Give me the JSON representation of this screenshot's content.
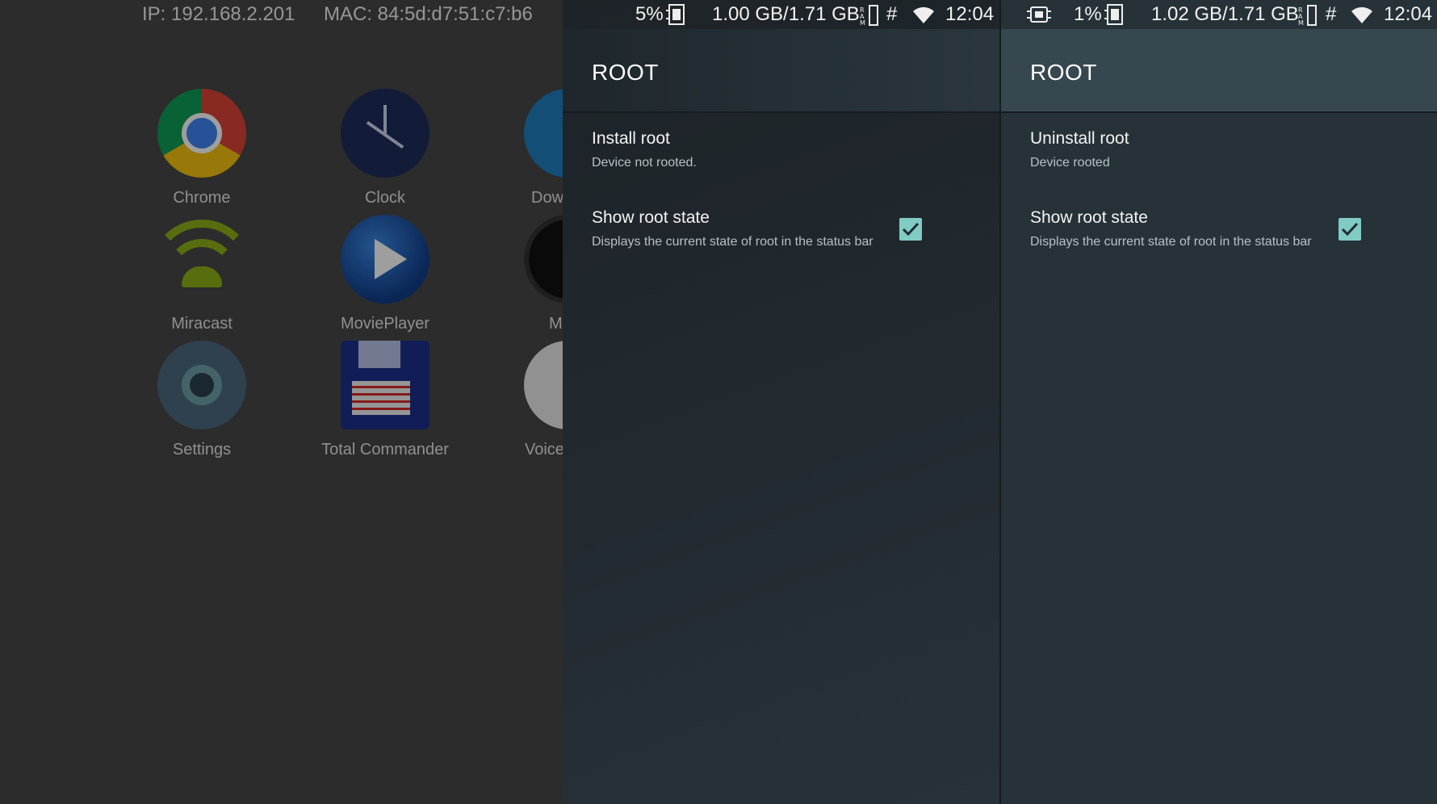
{
  "launcher": {
    "status": {
      "ip": "IP: 192.168.2.201",
      "mac": "MAC: 84:5d:d7:51:c7:b6"
    },
    "apps": [
      {
        "label": "Chrome"
      },
      {
        "label": "Clock"
      },
      {
        "label": "Dow"
      },
      {
        "label": "Miracast"
      },
      {
        "label": "MoviePlayer"
      },
      {
        "label": "M"
      },
      {
        "label": "Settings"
      },
      {
        "label": "Total Commander"
      },
      {
        "label": "Voice"
      }
    ]
  },
  "panel_left": {
    "status": {
      "battery_pct": "5%",
      "ram": "1.00 GB/1.71 GB",
      "time": "12:04"
    },
    "title": "ROOT",
    "prefs": [
      {
        "title": "Install root",
        "summary": "Device not rooted."
      },
      {
        "title": "Show root state",
        "summary": "Displays the current state of root in the status bar",
        "checked": true
      }
    ]
  },
  "panel_right": {
    "status": {
      "battery_pct": "1%",
      "ram": "1.02 GB/1.71 GB",
      "time": "12:04"
    },
    "title": "ROOT",
    "prefs": [
      {
        "title": "Uninstall root",
        "summary": "Device rooted"
      },
      {
        "title": "Show root state",
        "summary": "Displays the current state of root in the status bar",
        "checked": true
      }
    ]
  },
  "colors": {
    "accent_checkbox": "#80cbc4",
    "toolbar_dark": "#37474f",
    "panel_bg": "#263238"
  }
}
